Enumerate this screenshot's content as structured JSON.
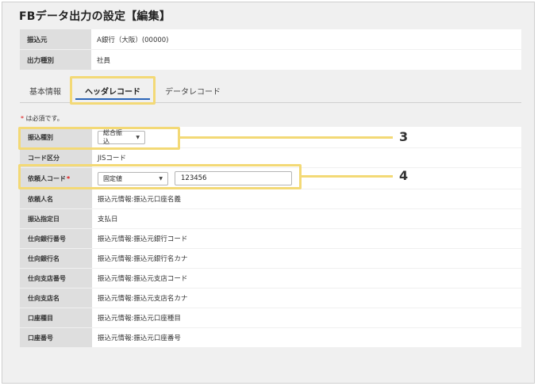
{
  "page": {
    "title": "FBデータ出力の設定【編集】"
  },
  "info": {
    "rows": [
      {
        "label": "振込元",
        "value": "A銀行（大阪）(00000)"
      },
      {
        "label": "出力種別",
        "value": "社員"
      }
    ]
  },
  "tabs": [
    {
      "label": "基本情報",
      "active": false
    },
    {
      "label": "ヘッダレコード",
      "active": true
    },
    {
      "label": "データレコード",
      "active": false
    }
  ],
  "required_note": {
    "star": "*",
    "text": "は必須です。"
  },
  "form": {
    "transfer_type": {
      "label": "振込種別",
      "selected": "総合振込"
    },
    "code_class": {
      "label": "コード区分",
      "value": "JISコード"
    },
    "requester_code": {
      "label": "依頼人コード",
      "star": "*",
      "selected": "固定値",
      "input_value": "123456"
    },
    "rows": [
      {
        "label": "依頼人名",
        "value": "振込元情報:振込元口座名義"
      },
      {
        "label": "振込指定日",
        "value": "支払日"
      },
      {
        "label": "仕向銀行番号",
        "value": "振込元情報:振込元銀行コード"
      },
      {
        "label": "仕向銀行名",
        "value": "振込元情報:振込元銀行名カナ"
      },
      {
        "label": "仕向支店番号",
        "value": "振込元情報:振込元支店コード"
      },
      {
        "label": "仕向支店名",
        "value": "振込元情報:振込元支店名カナ"
      },
      {
        "label": "口座種目",
        "value": "振込元情報:振込元口座種目"
      },
      {
        "label": "口座番号",
        "value": "振込元情報:振込元口座番号"
      }
    ]
  },
  "callouts": {
    "first": "3",
    "second": "4"
  },
  "icons": {
    "dropdown": "chevron-down-icon"
  },
  "colors": {
    "highlight": "#f3d976",
    "tab_underline": "#2a64b7",
    "required": "#dd1111"
  }
}
